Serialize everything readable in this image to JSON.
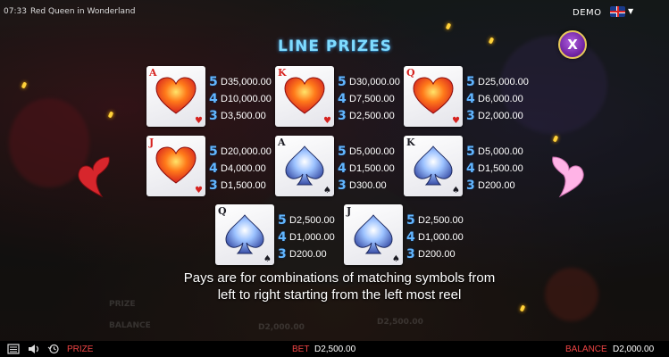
{
  "top_bar": {
    "time": "07:33",
    "game_title": "Red Queen in Wonderland",
    "mode": "DEMO",
    "language_icon": "uk-flag-icon"
  },
  "panel": {
    "title": "LINE PRIZES",
    "close_label": "X",
    "note_line1": "Pays are for combinations of matching symbols from",
    "note_line2": "left to right starting from the left most reel"
  },
  "colors": {
    "title": "#7fdcff",
    "count": "#62b6ff",
    "accent_red": "#e44444",
    "close_button": "#8a2fc4",
    "nav_left": "#e2383c",
    "nav_right": "#ffb8e8"
  },
  "symbols": [
    {
      "rank": "A",
      "suit": "heart",
      "pays": [
        {
          "count": "5",
          "value": "D35,000.00"
        },
        {
          "count": "4",
          "value": "D10,000.00"
        },
        {
          "count": "3",
          "value": "D3,500.00"
        }
      ]
    },
    {
      "rank": "K",
      "suit": "heart",
      "pays": [
        {
          "count": "5",
          "value": "D30,000.00"
        },
        {
          "count": "4",
          "value": "D7,500.00"
        },
        {
          "count": "3",
          "value": "D2,500.00"
        }
      ]
    },
    {
      "rank": "Q",
      "suit": "heart",
      "pays": [
        {
          "count": "5",
          "value": "D25,000.00"
        },
        {
          "count": "4",
          "value": "D6,000.00"
        },
        {
          "count": "3",
          "value": "D2,000.00"
        }
      ]
    },
    {
      "rank": "J",
      "suit": "heart",
      "pays": [
        {
          "count": "5",
          "value": "D20,000.00"
        },
        {
          "count": "4",
          "value": "D4,000.00"
        },
        {
          "count": "3",
          "value": "D1,500.00"
        }
      ]
    },
    {
      "rank": "A",
      "suit": "spade",
      "pays": [
        {
          "count": "5",
          "value": "D5,000.00"
        },
        {
          "count": "4",
          "value": "D1,500.00"
        },
        {
          "count": "3",
          "value": "D300.00"
        }
      ]
    },
    {
      "rank": "K",
      "suit": "spade",
      "pays": [
        {
          "count": "5",
          "value": "D5,000.00"
        },
        {
          "count": "4",
          "value": "D1,500.00"
        },
        {
          "count": "3",
          "value": "D200.00"
        }
      ]
    },
    {
      "rank": "Q",
      "suit": "spade",
      "pays": [
        {
          "count": "5",
          "value": "D2,500.00"
        },
        {
          "count": "4",
          "value": "D1,000.00"
        },
        {
          "count": "3",
          "value": "D200.00"
        }
      ]
    },
    {
      "rank": "J",
      "suit": "spade",
      "pays": [
        {
          "count": "5",
          "value": "D2,500.00"
        },
        {
          "count": "4",
          "value": "D1,000.00"
        },
        {
          "count": "3",
          "value": "D200.00"
        }
      ]
    }
  ],
  "background_hud": {
    "prize_label": "PRIZE",
    "balance_label": "BALANCE",
    "balance_value": "D2,000.00",
    "bet_value": "D2,500.00"
  },
  "bottom_bar": {
    "prize_label": "PRIZE",
    "bet_label": "BET",
    "bet_value": "D2,500.00",
    "balance_label": "BALANCE",
    "balance_value": "D2,000.00"
  }
}
